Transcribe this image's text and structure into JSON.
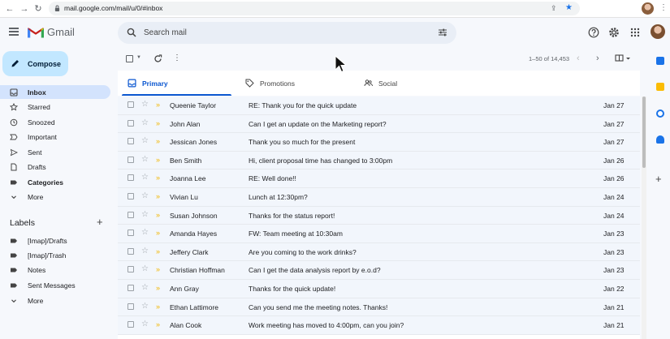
{
  "browser": {
    "url": "mail.google.com/mail/u/0/#inbox"
  },
  "header": {
    "app_name": "Gmail",
    "search_placeholder": "Search mail"
  },
  "sidebar": {
    "compose_label": "Compose",
    "items": [
      {
        "label": "Inbox",
        "icon": "inbox-icon",
        "active": true
      },
      {
        "label": "Starred",
        "icon": "star-icon"
      },
      {
        "label": "Snoozed",
        "icon": "clock-icon"
      },
      {
        "label": "Important",
        "icon": "important-icon"
      },
      {
        "label": "Sent",
        "icon": "send-icon"
      },
      {
        "label": "Drafts",
        "icon": "draft-icon"
      },
      {
        "label": "Categories",
        "icon": "label-icon",
        "bold": true
      },
      {
        "label": "More",
        "icon": "chevron-down-icon"
      }
    ],
    "labels_title": "Labels",
    "labels": [
      {
        "label": "[Imap]/Drafts",
        "icon": "label-icon"
      },
      {
        "label": "[Imap]/Trash",
        "icon": "label-icon"
      },
      {
        "label": "Notes",
        "icon": "label-icon"
      },
      {
        "label": "Sent Messages",
        "icon": "label-icon"
      },
      {
        "label": "More",
        "icon": "chevron-down-icon"
      }
    ]
  },
  "toolbar": {
    "pagination": "1–50 of 14,453"
  },
  "tabs": [
    {
      "label": "Primary",
      "icon": "inbox-icon",
      "active": true
    },
    {
      "label": "Promotions",
      "icon": "tag-icon"
    },
    {
      "label": "Social",
      "icon": "people-icon"
    }
  ],
  "emails": [
    {
      "sender": "Queenie Taylor",
      "subject": "RE: Thank you for the quick update",
      "date": "Jan 27"
    },
    {
      "sender": "John Alan",
      "subject": "Can I get an update on the Marketing report?",
      "date": "Jan 27"
    },
    {
      "sender": "Jessican Jones",
      "subject": "Thank you so much for the present",
      "date": "Jan 27"
    },
    {
      "sender": "Ben Smith",
      "subject": "Hi, client proposal time has changed to 3:00pm",
      "date": "Jan 26"
    },
    {
      "sender": "Joanna Lee",
      "subject": "RE: Well done!!",
      "date": "Jan 26"
    },
    {
      "sender": "Vivian Lu",
      "subject": "Lunch at 12:30pm?",
      "date": "Jan 24"
    },
    {
      "sender": "Susan Johnson",
      "subject": "Thanks for the status report!",
      "date": "Jan 24"
    },
    {
      "sender": "Amanda Hayes",
      "subject": "FW: Team meeting at 10:30am",
      "date": "Jan 23"
    },
    {
      "sender": "Jeffery Clark",
      "subject": "Are you coming to the work drinks?",
      "date": "Jan 23"
    },
    {
      "sender": "Christian Hoffman",
      "subject": "Can I get the data analysis report by e.o.d?",
      "date": "Jan 23"
    },
    {
      "sender": "Ann Gray",
      "subject": "Thanks for the quick update!",
      "date": "Jan 22"
    },
    {
      "sender": "Ethan Lattimore",
      "subject": "Can you send me the meeting notes. Thanks!",
      "date": "Jan 21"
    },
    {
      "sender": "Alan Cook",
      "subject": "Work meeting has moved to 4:00pm, can you join?",
      "date": "Jan 21"
    }
  ],
  "colors": {
    "accent": "#0b57d0",
    "compose_bg": "#c2e7ff",
    "active_nav": "#d3e3fd",
    "important_marker": "#f2b600"
  }
}
